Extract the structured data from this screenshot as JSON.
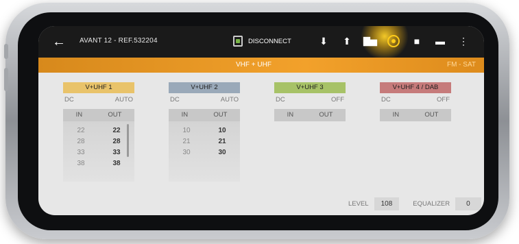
{
  "app": {
    "title": "AVANT 12 - REF.532204",
    "disconnect_label": "DISCONNECT",
    "toolbar_icons": [
      "download-icon",
      "upload-icon",
      "bar-chart-icon",
      "settings-icon",
      "save-icon",
      "folder-icon",
      "more-icon"
    ]
  },
  "tabs": {
    "main": "VHF + UHF",
    "secondary": "FM - SAT"
  },
  "panels": [
    {
      "name": "V+UHF 1",
      "color": "#e9c36a",
      "dc_label": "DC",
      "mode": "AUTO",
      "in_label": "IN",
      "out_label": "OUT",
      "rows": [
        {
          "in": "22",
          "out": "22"
        },
        {
          "in": "28",
          "out": "28"
        },
        {
          "in": "33",
          "out": "33"
        },
        {
          "in": "38",
          "out": "38"
        }
      ]
    },
    {
      "name": "V+UHF 2",
      "color": "#9aa9b9",
      "dc_label": "DC",
      "mode": "AUTO",
      "in_label": "IN",
      "out_label": "OUT",
      "rows": [
        {
          "in": "10",
          "out": "10"
        },
        {
          "in": "21",
          "out": "21"
        },
        {
          "in": "30",
          "out": "30"
        }
      ]
    },
    {
      "name": "V+UHF 3",
      "color": "#a7c267",
      "dc_label": "DC",
      "mode": "OFF",
      "in_label": "IN",
      "out_label": "OUT",
      "rows": []
    },
    {
      "name": "V+UHF 4 / DAB",
      "color": "#c67b7b",
      "dc_label": "DC",
      "mode": "OFF",
      "in_label": "IN",
      "out_label": "OUT",
      "rows": []
    }
  ],
  "footer": {
    "level_label": "LEVEL",
    "level_value": "108",
    "equalizer_label": "EQUALIZER",
    "equalizer_value": "0"
  },
  "colors": {
    "accent": "#f2a12b",
    "topbar": "#1a1a1a",
    "glow": "#ffcc1a"
  }
}
